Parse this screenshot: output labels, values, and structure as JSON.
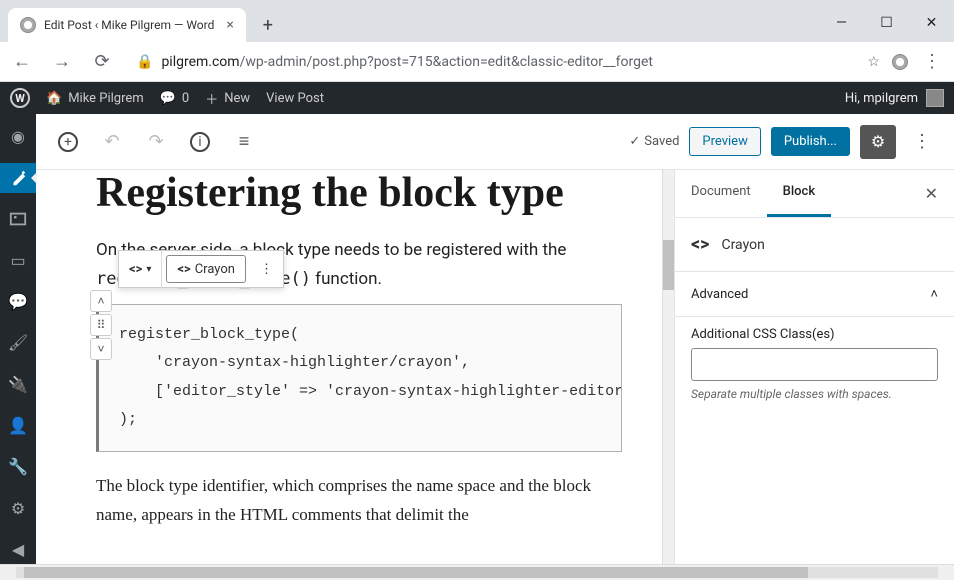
{
  "browser": {
    "tab_title": "Edit Post ‹ Mike Pilgrem — Word",
    "url_host": "pilgrem.com",
    "url_path": "/wp-admin/post.php?post=715&action=edit&classic-editor__forget"
  },
  "adminbar": {
    "site_name": "Mike Pilgrem",
    "comments_count": "0",
    "new_label": "New",
    "view_label": "View Post",
    "greeting": "Hi, mpilgrem"
  },
  "topbar": {
    "saved_label": "Saved",
    "preview_label": "Preview",
    "publish_label": "Publish..."
  },
  "post": {
    "title": "Registering the block type",
    "para1_a": "On the server side, a block type needs to be registered with the ",
    "para1_code": "register_block_type()",
    "para1_b": " function.",
    "code": "register_block_type(\n    'crayon-syntax-highlighter/crayon',\n    ['editor_style' => 'crayon-syntax-highlighter-editor']\n);",
    "para2": "The block type identifier, which comprises the name space and the block name, appears in the HTML comments that delimit the"
  },
  "block_toolbar": {
    "crayon_label": "Crayon"
  },
  "settings": {
    "tab_document": "Document",
    "tab_block": "Block",
    "block_name": "Crayon",
    "section_advanced": "Advanced",
    "css_label": "Additional CSS Class(es)",
    "css_value": "",
    "css_hint": "Separate multiple classes with spaces."
  }
}
